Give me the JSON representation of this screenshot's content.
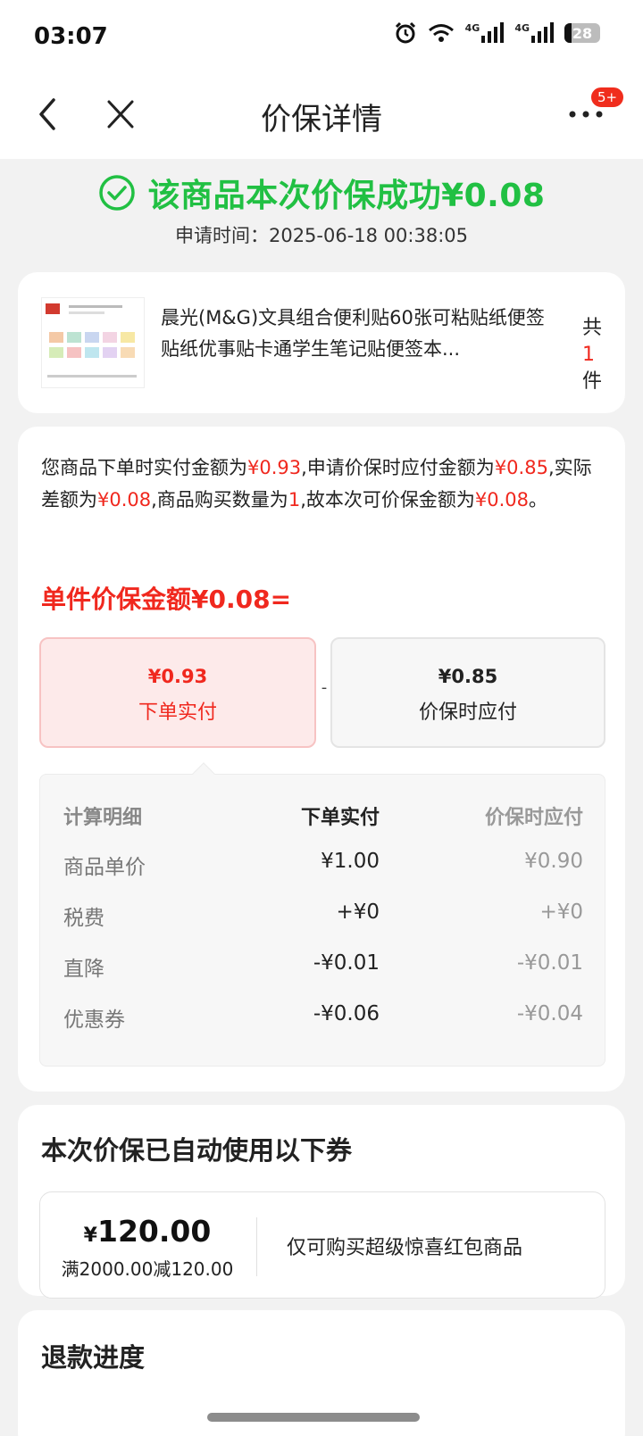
{
  "status_bar": {
    "time": "03:07",
    "network1": "4G",
    "network2": "4G",
    "battery": "28"
  },
  "nav": {
    "title": "价保详情",
    "badge": "5+"
  },
  "result": {
    "headline": "该商品本次价保成功¥0.08",
    "apply_time": "申请时间：2025-06-18 00:38:05"
  },
  "product": {
    "name": "晨光(M&G)文具组合便利贴60张可粘贴纸便签贴纸优事贴卡通学生笔记贴便签本...",
    "count_prefix": "共",
    "count": "1",
    "count_suffix": "件"
  },
  "calc": {
    "desc": {
      "t1": "您商品下单时实付金额为",
      "v1": "¥0.93",
      "t2": ",申请价保时应付金额为",
      "v2": "¥0.85",
      "t3": ",实际差额为",
      "v3": "¥0.08",
      "t4": ",商品购买数量为",
      "v4": "1",
      "t5": ",故本次可价保金额为",
      "v5": "¥0.08",
      "t6": "。"
    },
    "unit_title": "单件价保金额¥0.08=",
    "left_box": {
      "amount": "¥0.93",
      "label": "下单实付"
    },
    "minus": "-",
    "right_box": {
      "amount": "¥0.85",
      "label": "价保时应付"
    },
    "detail": {
      "headers": [
        "计算明细",
        "下单实付",
        "价保时应付"
      ],
      "rows": [
        [
          "商品单价",
          "¥1.00",
          "¥0.90"
        ],
        [
          "税费",
          "+¥0",
          "+¥0"
        ],
        [
          "直降",
          "-¥0.01",
          "-¥0.01"
        ],
        [
          "优惠券",
          "-¥0.06",
          "-¥0.04"
        ]
      ]
    }
  },
  "coupon_section": {
    "title": "本次价保已自动使用以下券",
    "coupon": {
      "currency": "¥",
      "amount": "120.00",
      "condition": "满2000.00减120.00",
      "description": "仅可购买超级惊喜红包商品"
    }
  },
  "refund": {
    "title": "退款进度"
  },
  "colors": {
    "success_green": "#21c043",
    "accent_red": "#f0281e"
  }
}
